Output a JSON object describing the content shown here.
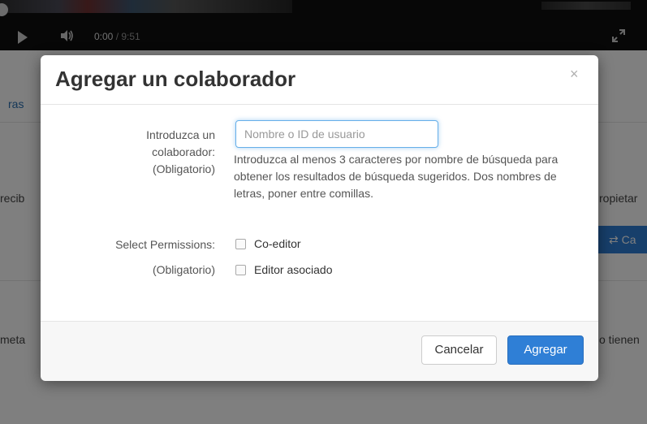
{
  "video": {
    "current_time": "0:00",
    "duration": "/ 9:51"
  },
  "background": {
    "tab_label": "ras",
    "text_left_1": "recib",
    "text_right_1": "ropietar",
    "button_label": "⇄ Ca",
    "text_left_2": "meta",
    "text_right_2": "o tienen"
  },
  "modal": {
    "title": "Agregar un colaborador",
    "close_symbol": "×",
    "collaborator_label": [
      "Introduzca un",
      "colaborador:",
      "(Obligatorio)"
    ],
    "search_placeholder": "Nombre o ID de usuario",
    "search_value": "",
    "help_text": "Introduzca al menos 3 caracteres por nombre de búsqueda para obtener los resultados de búsqueda sugeridos. Dos nombres de letras, poner entre comillas.",
    "permissions_label": [
      "Select Permissions:",
      "(Obligatorio)"
    ],
    "permissions": [
      {
        "label": "Co-editor",
        "checked": false
      },
      {
        "label": "Editor asociado",
        "checked": false
      }
    ],
    "cancel_label": "Cancelar",
    "submit_label": "Agregar"
  },
  "icons": {
    "play": "play-icon",
    "volume": "volume-icon",
    "fullscreen": "fullscreen-icon",
    "close": "close-icon"
  },
  "colors": {
    "primary": "#2f7fd6",
    "focus_border": "#66afe9"
  }
}
